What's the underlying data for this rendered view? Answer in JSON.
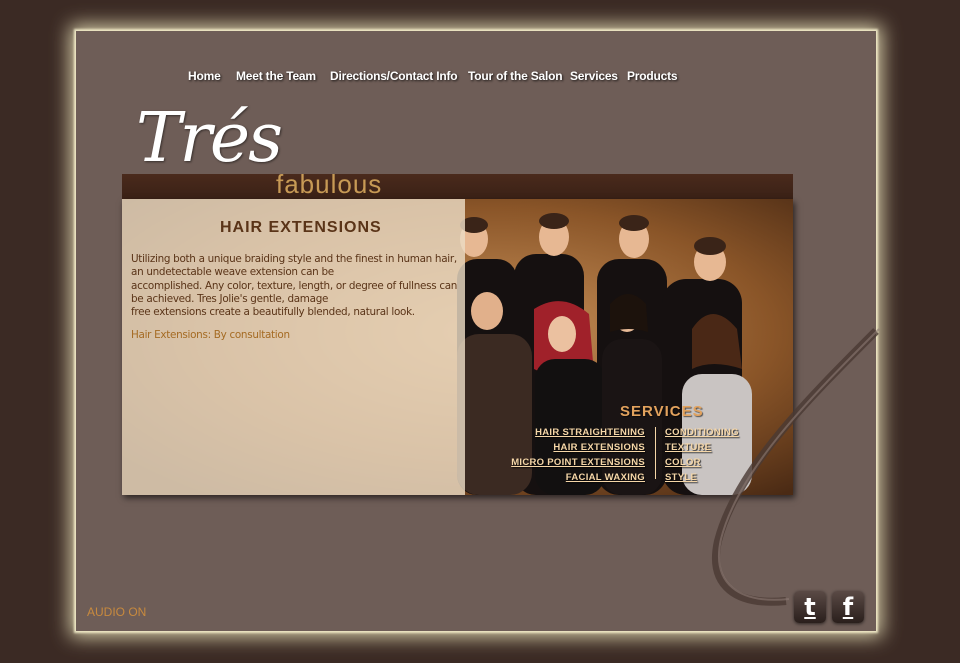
{
  "nav": {
    "items": [
      "Home",
      "Meet the Team",
      "Directions/Contact Info",
      "Tour of the Salon",
      "Services",
      "Products"
    ]
  },
  "logo": {
    "script": "Trés",
    "sub": "fabulous"
  },
  "main": {
    "heading": "HAIR EXTENSIONS",
    "paragraph_lines": [
      "Utilizing both a unique braiding style and the finest in human hair,",
      "an undetectable weave extension can be",
      "accomplished.  Any color, texture, length, or degree of fullness can",
      "be achieved.  Tres Jolie's gentle, damage",
      "free extensions create a beautifully blended, natural look."
    ],
    "price_line": "Hair Extensions:  By consultation"
  },
  "services": {
    "title": "SERVICES",
    "left": [
      "HAIR STRAIGHTENING",
      "HAIR EXTENSIONS",
      "MICRO POINT EXTENSIONS",
      "FACIAL WAXING"
    ],
    "right": [
      "CONDITIONING",
      "TEXTURE",
      "COLOR",
      "STYLE"
    ]
  },
  "footer": {
    "audio_label": "AUDIO ON"
  },
  "social": {
    "twitter_glyph": "t",
    "facebook_glyph": "f"
  },
  "colors": {
    "frame_bg": "#6e5d57",
    "page_bg": "#3b2a24",
    "accent_orange": "#c88a3e",
    "heading_brown": "#5a3418"
  }
}
